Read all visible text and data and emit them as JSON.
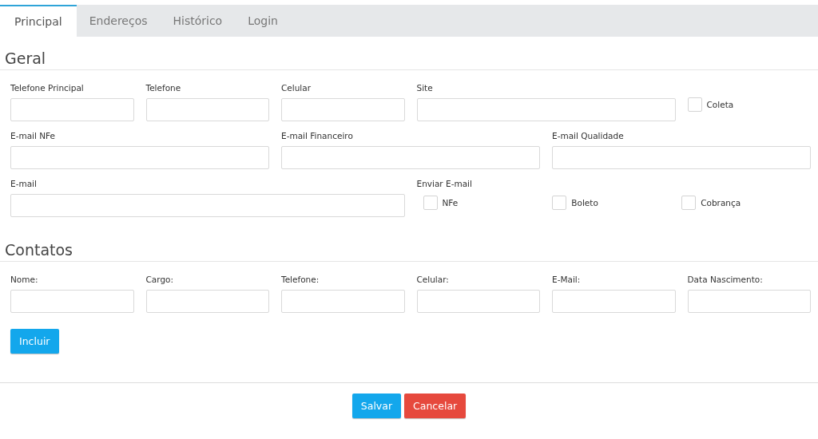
{
  "tabs": [
    {
      "label": "Principal",
      "selected": true
    },
    {
      "label": "Endereços",
      "selected": false
    },
    {
      "label": "Histórico",
      "selected": false
    },
    {
      "label": "Login",
      "selected": false
    }
  ],
  "geral": {
    "title": "Geral",
    "fields": [
      {
        "kind": "text",
        "label": "Telefone Principal"
      },
      {
        "kind": "text",
        "label": "Telefone"
      },
      {
        "kind": "text",
        "label": "Celular"
      },
      {
        "kind": "text",
        "label": "Site"
      },
      {
        "kind": "checkbox",
        "label": "Coleta",
        "checked": false
      },
      {
        "kind": "text",
        "label": "E-mail NFe"
      },
      {
        "kind": "text",
        "label": "E-mail Financeiro"
      },
      {
        "kind": "text",
        "label": "E-mail Qualidade"
      },
      {
        "kind": "text",
        "label": "E-mail"
      },
      {
        "kind": "group",
        "label": "Enviar E-mail",
        "options": [
          {
            "label": "NFe",
            "checked": false
          },
          {
            "label": "Boleto",
            "checked": false
          },
          {
            "label": "Cobrança",
            "checked": false
          }
        ]
      }
    ]
  },
  "contatos": {
    "title": "Contatos",
    "fields": [
      {
        "label": "Nome:"
      },
      {
        "label": "Cargo:"
      },
      {
        "label": "Telefone:"
      },
      {
        "label": "Celular:"
      },
      {
        "label": "E-Mail:"
      },
      {
        "label": "Data Nascimento:"
      }
    ],
    "add_button": "Incluir"
  },
  "buttons": [
    {
      "kind": "primary",
      "label": "Salvar"
    },
    {
      "kind": "danger",
      "label": "Cancelar"
    }
  ]
}
